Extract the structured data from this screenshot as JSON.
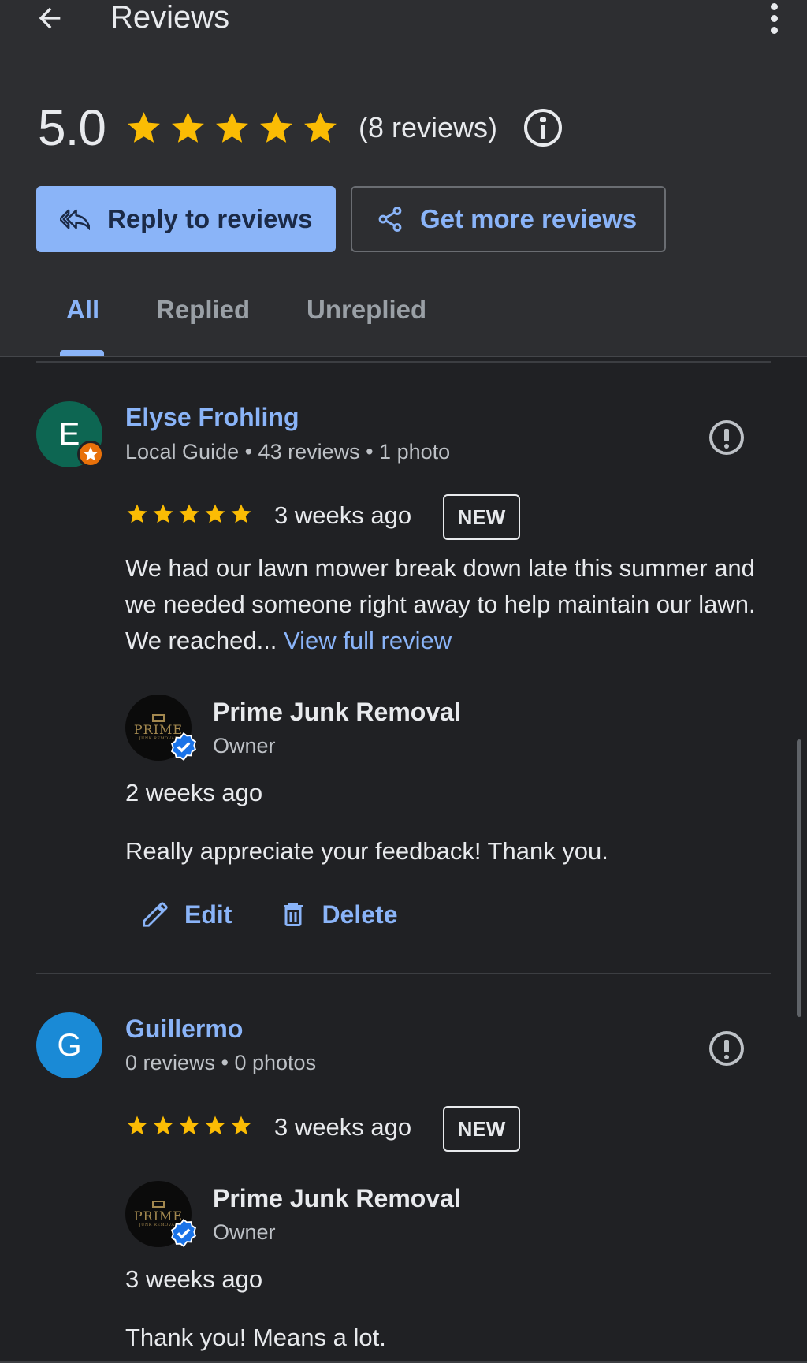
{
  "header": {
    "title": "Reviews",
    "rating": "5.0",
    "stars": 5,
    "review_count": "(8 reviews)",
    "reply_button": "Reply to reviews",
    "get_more_button": "Get more reviews"
  },
  "tabs": [
    {
      "label": "All",
      "active": true
    },
    {
      "label": "Replied",
      "active": false
    },
    {
      "label": "Unreplied",
      "active": false
    }
  ],
  "colors": {
    "accent": "#8ab4f8",
    "star": "#fbbc04",
    "background": "#202124",
    "header_bg": "#2d2e31"
  },
  "reviews": [
    {
      "initial": "E",
      "avatar_color": "#0d6652",
      "local_guide": true,
      "name": "Elyse Frohling",
      "meta": "Local Guide • 43 reviews • 1 photo",
      "stars": 5,
      "time": "3 weeks ago",
      "badge": "NEW",
      "text": "We had our lawn mower break down late this summer and we needed someone right away to help maintain our lawn. We reached... ",
      "view_full": "View full review",
      "reply": {
        "owner_name": "Prime Junk Removal",
        "owner_role": "Owner",
        "logo_text": "PRIME",
        "logo_sub": "JUNK REMOVAL",
        "time": "2 weeks ago",
        "text": "Really appreciate your feedback! Thank you.",
        "edit_label": "Edit",
        "delete_label": "Delete"
      }
    },
    {
      "initial": "G",
      "avatar_color": "#1a8ad6",
      "local_guide": false,
      "name": "Guillermo",
      "meta": "0 reviews • 0 photos",
      "stars": 5,
      "time": "3 weeks ago",
      "badge": "NEW",
      "reply": {
        "owner_name": "Prime Junk Removal",
        "owner_role": "Owner",
        "logo_text": "PRIME",
        "logo_sub": "JUNK REMOVAL",
        "time": "3 weeks ago",
        "text": "Thank you! Means a lot."
      }
    }
  ]
}
